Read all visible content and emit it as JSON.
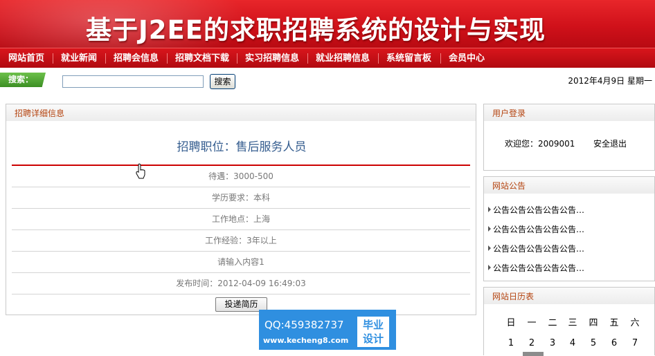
{
  "banner": {
    "title": "基于J2EE的求职招聘系统的设计与实现"
  },
  "nav": {
    "items": [
      "网站首页",
      "就业新闻",
      "招聘会信息",
      "招聘文档下载",
      "实习招聘信息",
      "就业招聘信息",
      "系统留言板",
      "会员中心"
    ]
  },
  "search": {
    "label": "搜索：",
    "value": "",
    "button": "搜索",
    "date": "2012年4月9日  星期一"
  },
  "detail": {
    "panel_title": "招聘详细信息",
    "job_title": "招聘职位：售后服务人员",
    "rows": [
      "待遇：3000-500",
      "学历要求：本科",
      "工作地点：上海",
      "工作经验：3年以上",
      "请输入内容1",
      "发布时间：2012-04-09 16:49:03"
    ],
    "apply_button": "投递简历"
  },
  "login": {
    "panel_title": "用户登录",
    "welcome": "欢迎您：2009001",
    "logout": "安全退出"
  },
  "notices": {
    "panel_title": "网站公告",
    "items": [
      "公告公告公告公告公告…",
      "公告公告公告公告公告…",
      "公告公告公告公告公告…",
      "公告公告公告公告公告…"
    ]
  },
  "calendar": {
    "panel_title": "网站日历表",
    "weekdays": [
      "日",
      "一",
      "二",
      "三",
      "四",
      "五",
      "六"
    ],
    "days": [
      "1",
      "2",
      "3",
      "4",
      "5",
      "6",
      "7"
    ]
  },
  "watermark": {
    "qq": "QQ:459382737",
    "url": "www.kecheng8.com",
    "badge_line1": "毕业",
    "badge_line2": "设计"
  },
  "colors": {
    "brand_red": "#d0111a",
    "accent_green": "#4aa52c",
    "watermark_blue": "#2f8fe0",
    "panel_title": "#b4430f"
  }
}
